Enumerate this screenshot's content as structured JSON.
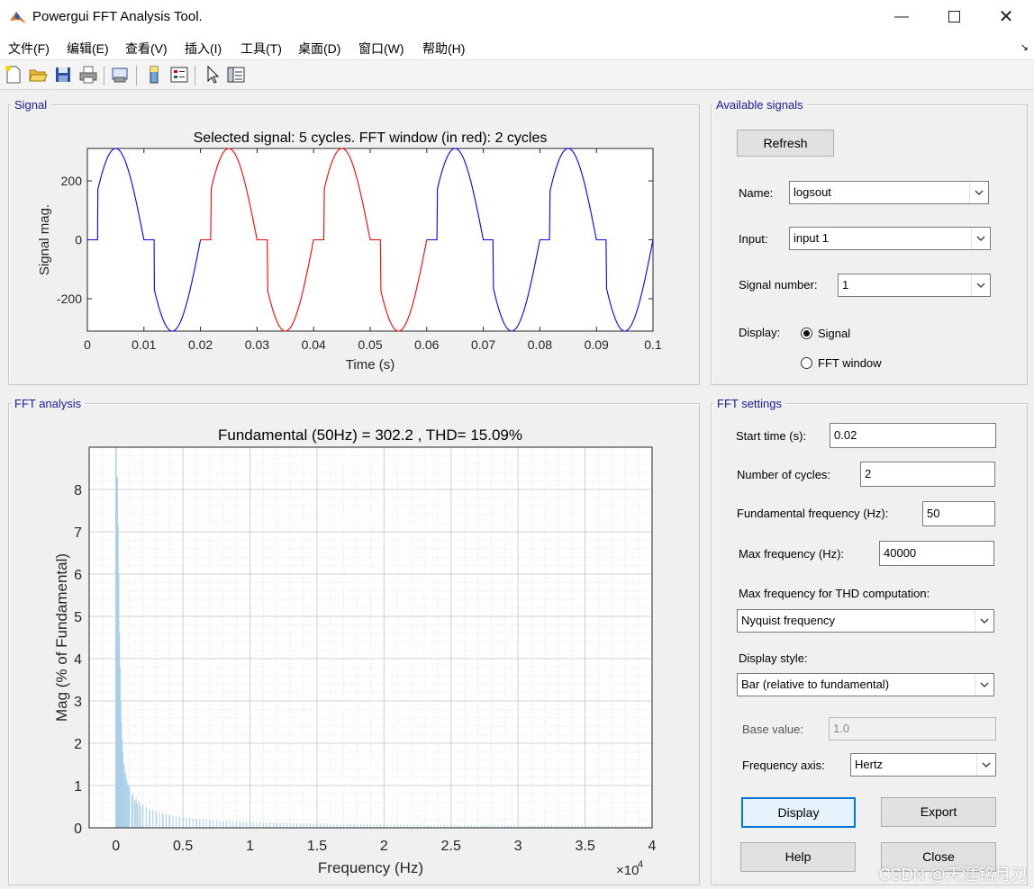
{
  "window": {
    "title": "Powergui FFT Analysis Tool.",
    "minimize_icon": "minimize-icon",
    "maximize_icon": "maximize-icon",
    "close_icon": "close-icon"
  },
  "menu": [
    "文件(F)",
    "编辑(E)",
    "查看(V)",
    "插入(I)",
    "工具(T)",
    "桌面(D)",
    "窗口(W)",
    "帮助(H)"
  ],
  "toolbar": [
    "new-figure-icon",
    "open-file-icon",
    "save-icon",
    "print-icon",
    "print-preview-icon",
    "colorbar-icon",
    "legend-icon",
    "pointer-icon",
    "property-editor-icon"
  ],
  "signal_panel": {
    "title": "Signal",
    "chart_title": "Selected signal: 5 cycles. FFT window (in red): 2 cycles",
    "xlabel": "Time (s)",
    "ylabel": "Signal mag.",
    "xticks": [
      "0",
      "0.01",
      "0.02",
      "0.03",
      "0.04",
      "0.05",
      "0.06",
      "0.07",
      "0.08",
      "0.09",
      "0.1"
    ],
    "yticks": [
      "200",
      "0",
      "-200"
    ]
  },
  "fft_panel": {
    "title": "FFT analysis",
    "chart_title": "Fundamental (50Hz) = 302.2 , THD= 15.09%",
    "xlabel": "Frequency (Hz)",
    "ylabel": "Mag (% of Fundamental)",
    "xticks": [
      "0",
      "0.5",
      "1",
      "1.5",
      "2",
      "2.5",
      "3",
      "3.5",
      "4"
    ],
    "yticks": [
      "0",
      "1",
      "2",
      "3",
      "4",
      "5",
      "6",
      "7",
      "8"
    ],
    "exponent_base": "×10",
    "exponent_power": "4"
  },
  "available": {
    "title": "Available signals",
    "refresh": "Refresh",
    "name_label": "Name:",
    "name_value": "logsout",
    "input_label": "Input:",
    "input_value": "input 1",
    "signal_number_label": "Signal number:",
    "signal_number_value": "1",
    "display_label": "Display:",
    "radio_signal": "Signal",
    "radio_fft": "FFT window",
    "selected": "Signal"
  },
  "settings": {
    "title": "FFT settings",
    "start_time_label": "Start time (s):",
    "start_time": "0.02",
    "cycles_label": "Number of cycles:",
    "cycles": "2",
    "fund_label": "Fundamental frequency (Hz):",
    "fund": "50",
    "maxf_label": "Max frequency (Hz):",
    "maxf": "40000",
    "thd_label": "Max frequency for THD computation:",
    "thd_value": "Nyquist frequency",
    "style_label": "Display style:",
    "style_value": "Bar (relative to fundamental)",
    "base_label": "Base value:",
    "base_value": "1.0",
    "faxis_label": "Frequency axis:",
    "faxis_value": "Hertz"
  },
  "buttons": {
    "display": "Display",
    "export": "Export",
    "help": "Help",
    "close": "Close"
  },
  "watermark": "CSDN @天涯铭月刀",
  "chart_data": [
    {
      "type": "line",
      "title": "Selected signal: 5 cycles. FFT window (in red): 2 cycles",
      "xlabel": "Time (s)",
      "ylabel": "Signal mag.",
      "xlim": [
        0,
        0.1
      ],
      "ylim": [
        -310,
        310
      ],
      "description_of_shape": "chopped sinusoid, 50 Hz, amplitude ~310, zero between crossings and ~0.002 s after",
      "amplitude": 310,
      "frequency_hz": 50,
      "dead_time_s": 0.0018,
      "series": [
        {
          "color": "#0000ff",
          "x_range": [
            0,
            0.02
          ]
        },
        {
          "color": "#ff0000",
          "x_range": [
            0.02,
            0.06
          ]
        },
        {
          "color": "#0000ff",
          "x_range": [
            0.06,
            0.1
          ]
        }
      ]
    },
    {
      "type": "bar",
      "title": "Fundamental (50Hz) = 302.2 , THD= 15.09%",
      "xlabel": "Frequency (Hz)",
      "ylabel": "Mag (% of Fundamental)",
      "xlim": [
        -2000,
        40000
      ],
      "ylim": [
        0,
        9
      ],
      "bar_color": "#a9cfe8",
      "harmonics_x": [
        0,
        100,
        150,
        200,
        250,
        300,
        350,
        400,
        450,
        500,
        600,
        700,
        800,
        900,
        1000,
        1200,
        1400,
        1600,
        1800,
        2000,
        2500,
        3000,
        3500,
        4000,
        5000,
        6000,
        7000,
        8000,
        10000,
        12000,
        15000,
        20000,
        25000,
        30000,
        35000,
        40000
      ],
      "harmonics_y": [
        9.0,
        8.3,
        7.2,
        6.0,
        4.6,
        3.8,
        3.0,
        2.5,
        2.1,
        1.8,
        1.5,
        1.3,
        1.15,
        1.0,
        0.9,
        0.75,
        0.65,
        0.58,
        0.52,
        0.48,
        0.4,
        0.34,
        0.3,
        0.27,
        0.22,
        0.19,
        0.17,
        0.15,
        0.12,
        0.1,
        0.08,
        0.06,
        0.05,
        0.04,
        0.035,
        0.03
      ],
      "grid": true,
      "minor_grid": true
    }
  ]
}
